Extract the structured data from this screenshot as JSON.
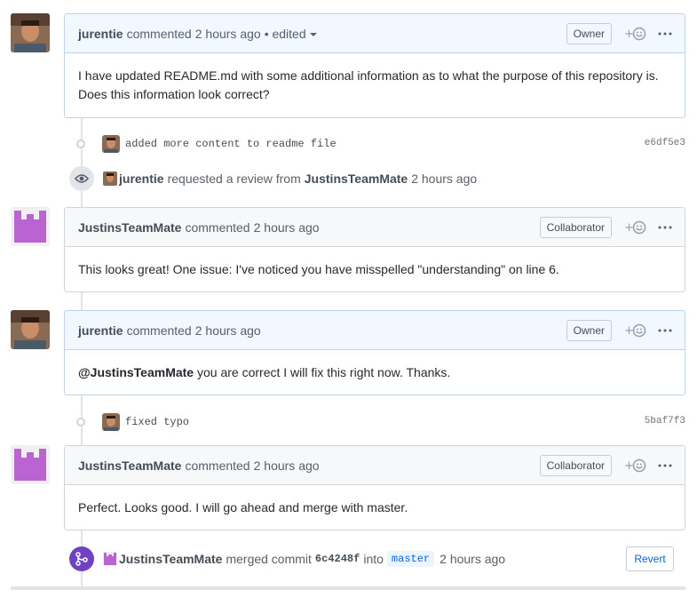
{
  "comments": [
    {
      "author": "jurentie",
      "action": "commented",
      "time": "2 hours ago",
      "edited": "• edited",
      "role": "Owner",
      "body": "I have updated README.md with some additional information as to what the purpose of this repository is. Does this information look correct?"
    },
    {
      "author": "JustinsTeamMate",
      "action": "commented",
      "time": "2 hours ago",
      "role": "Collaborator",
      "body": "This looks great! One issue: I've noticed you have misspelled \"understanding\" on line 6."
    },
    {
      "author": "jurentie",
      "action": "commented",
      "time": "2 hours ago",
      "role": "Owner",
      "mention": "@JustinsTeamMate",
      "body_rest": " you are correct I will fix this right now. Thanks."
    },
    {
      "author": "JustinsTeamMate",
      "action": "commented",
      "time": "2 hours ago",
      "role": "Collaborator",
      "body": "Perfect. Looks good. I will go ahead and merge with master."
    }
  ],
  "commits": [
    {
      "message": "added more content to readme file",
      "sha": "e6df5e3"
    },
    {
      "message": "fixed typo",
      "sha": "5baf7f3"
    }
  ],
  "review_event": {
    "actor": "jurentie",
    "text": "requested a review from",
    "reviewer": "JustinsTeamMate",
    "time": "2 hours ago"
  },
  "merge_event": {
    "actor": "JustinsTeamMate",
    "text": "merged commit",
    "sha": "6c4248f",
    "into": "into",
    "branch": "master",
    "time": "2 hours ago",
    "revert_label": "Revert"
  },
  "icons": {
    "reaction": "smiley-plus-icon",
    "more": "kebab-horizontal-icon",
    "eye": "eye-icon",
    "merge": "git-merge-icon"
  },
  "colors": {
    "merge_purple": "#6f42c1",
    "link_blue": "#0366d6",
    "identicon_purple": "#b964d0"
  }
}
